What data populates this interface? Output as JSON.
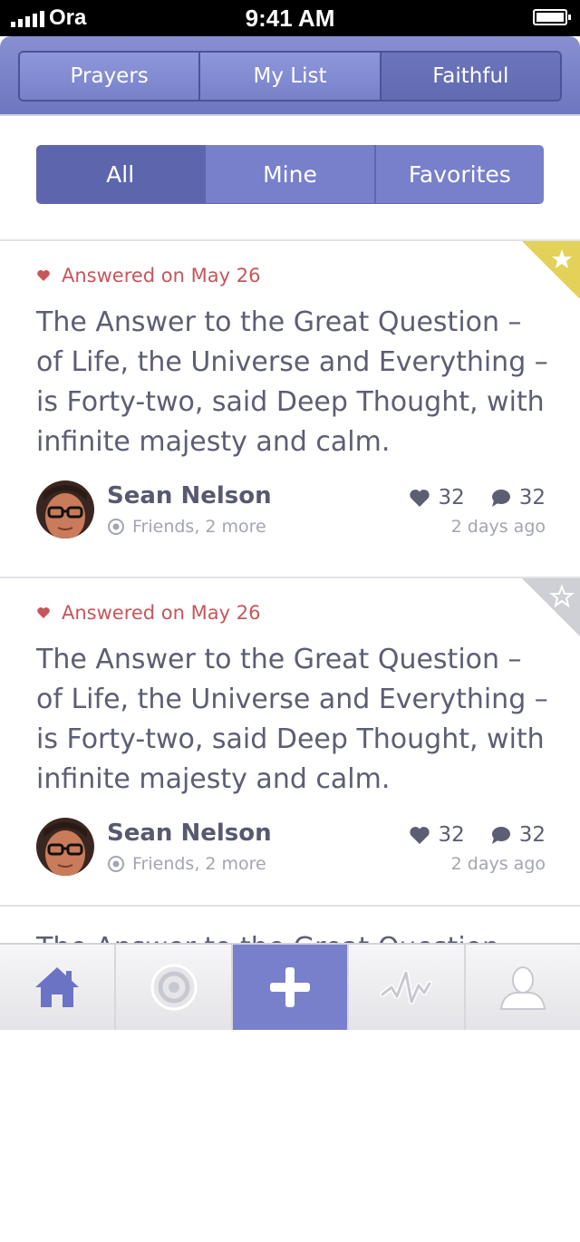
{
  "status_bar": {
    "carrier": "Ora",
    "time": "9:41 AM"
  },
  "header": {
    "tabs": [
      {
        "label": "Prayers"
      },
      {
        "label": "My List"
      },
      {
        "label": "Faithful"
      }
    ],
    "active_tab": "Faithful"
  },
  "filter": {
    "options": [
      {
        "label": "All"
      },
      {
        "label": "Mine"
      },
      {
        "label": "Favorites"
      }
    ],
    "active": "All"
  },
  "cards": [
    {
      "answered": "Answered on May 26",
      "text": "The Answer to the Great Question – of Life, the Universe and Everything – is Forty-two, said Deep Thought, with infinite majesty and calm.",
      "author": "Sean Nelson",
      "audience": "Friends, 2 more",
      "likes": "32",
      "comments": "32",
      "time": "2 days ago",
      "favorited": true
    },
    {
      "answered": "Answered on May 26",
      "text": "The Answer to the Great Question – of Life, the Universe and Everything – is Forty-two, said Deep Thought, with infinite majesty and calm.",
      "author": "Sean Nelson",
      "audience": "Friends, 2 more",
      "likes": "32",
      "comments": "32",
      "time": "2 days ago",
      "favorited": false
    },
    {
      "text": "The Answer to the Great Question"
    }
  ],
  "tabbar": {
    "items": [
      {
        "icon": "home-icon"
      },
      {
        "icon": "target-icon"
      },
      {
        "icon": "plus-icon"
      },
      {
        "icon": "activity-icon"
      },
      {
        "icon": "profile-icon"
      }
    ],
    "active_index": 2
  },
  "colors": {
    "accent": "#7880cb",
    "accent_dark": "#5d66ad",
    "answered": "#c8555a",
    "favorite_ribbon": "#e3d15a",
    "unfavorite_ribbon": "#cfcfd6"
  }
}
